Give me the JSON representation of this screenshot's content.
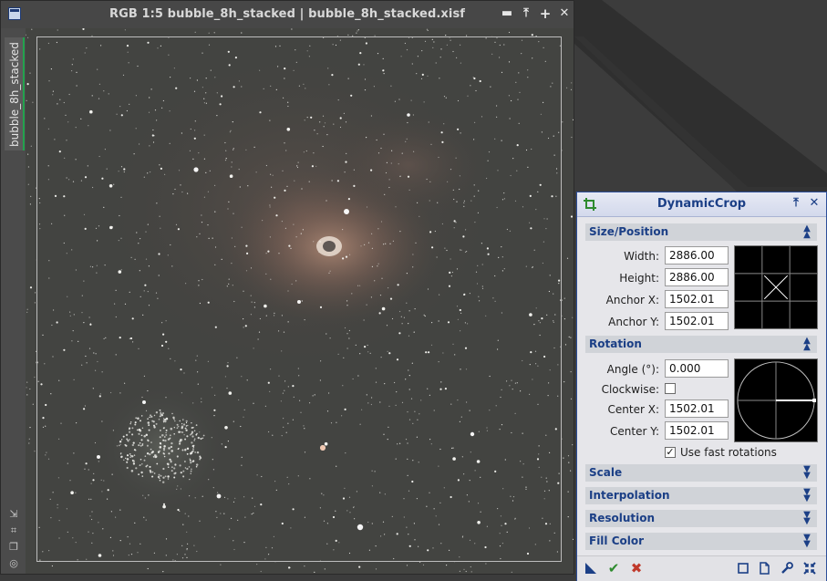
{
  "window": {
    "title": "RGB 1:5 bubble_8h_stacked | bubble_8h_stacked.xisf",
    "side_tab_label": "bubble_8h_stacked",
    "buttons": {
      "shade": "▬",
      "minimize": "⤒",
      "maximize": "+",
      "close": "✕"
    },
    "rail_icons": [
      "arrow-icon",
      "fit-icon",
      "clone-icon",
      "target-icon"
    ]
  },
  "dialog": {
    "title": "DynamicCrop",
    "size_position": {
      "header": "Size/Position",
      "width_label": "Width:",
      "width_value": "2886.00",
      "height_label": "Height:",
      "height_value": "2886.00",
      "anchor_x_label": "Anchor X:",
      "anchor_x_value": "1502.01",
      "anchor_y_label": "Anchor Y:",
      "anchor_y_value": "1502.01"
    },
    "rotation": {
      "header": "Rotation",
      "angle_label": "Angle (°):",
      "angle_value": "0.000",
      "clockwise_label": "Clockwise:",
      "clockwise_checked": false,
      "center_x_label": "Center X:",
      "center_x_value": "1502.01",
      "center_y_label": "Center Y:",
      "center_y_value": "1502.01",
      "fast_rotations_label": "Use fast rotations",
      "fast_rotations_checked": true
    },
    "collapsed_sections": [
      "Scale",
      "Interpolation",
      "Resolution",
      "Fill Color"
    ],
    "bottom_buttons": [
      "new-instance-icon",
      "execute-icon",
      "cancel-icon",
      "reset-icon",
      "browse-doc-icon",
      "preferences-icon",
      "global-icon"
    ]
  },
  "colors": {
    "accent": "#1b3f86",
    "execute": "#2e8b2e",
    "cancel": "#c0392b",
    "tab_active": "#23a24d"
  }
}
